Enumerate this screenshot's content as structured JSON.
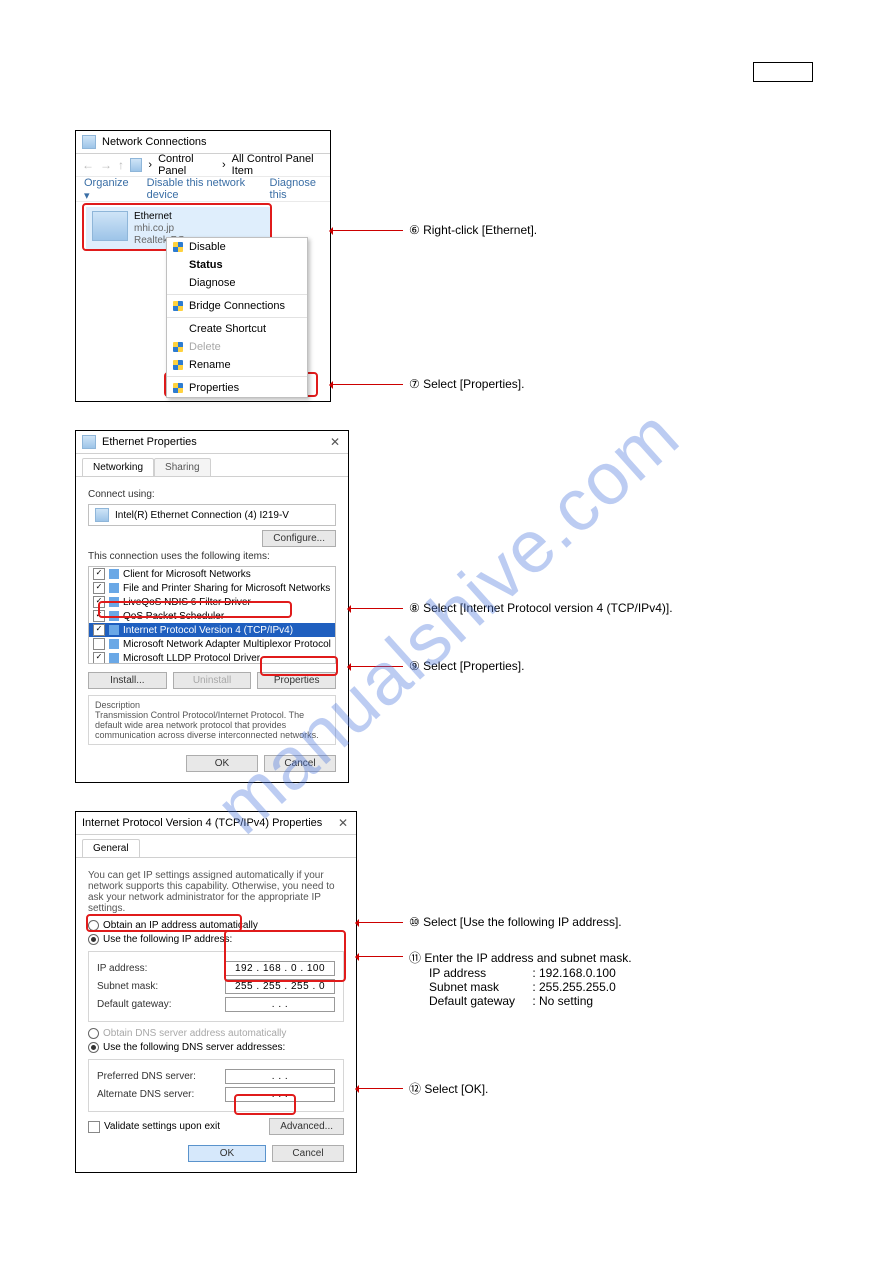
{
  "watermark": "manualshive.com",
  "fig1": {
    "title": "Network Connections",
    "nav_back": "←",
    "nav_fwd": "→",
    "nav_up": "↑",
    "breadcrumb_a": "Control Panel",
    "breadcrumb_sep": "›",
    "breadcrumb_b": "All Control Panel Item",
    "toolbar": {
      "organize": "Organize ▾",
      "disable": "Disable this network device",
      "diagnose": "Diagnose this"
    },
    "adapter": {
      "name": "Ethernet",
      "domain": "mhi.co.jp",
      "driver": "Realtek PC"
    },
    "ctx": {
      "disable": "Disable",
      "status": "Status",
      "diagnose": "Diagnose",
      "bridge": "Bridge Connections",
      "shortcut": "Create Shortcut",
      "delete": "Delete",
      "rename": "Rename",
      "properties": "Properties"
    },
    "annot6": "⑥ Right-click [Ethernet].",
    "annot7": "⑦ Select [Properties]."
  },
  "fig2": {
    "title": "Ethernet Properties",
    "tab_net": "Networking",
    "tab_share": "Sharing",
    "connect_using": "Connect using:",
    "adapter": "Intel(R) Ethernet Connection (4) I219-V",
    "configure": "Configure...",
    "uses_label": "This connection uses the following items:",
    "items": [
      "Client for Microsoft Networks",
      "File and Printer Sharing for Microsoft Networks",
      "LiveQoS NDIS 6 Filter Driver",
      "QoS Packet Scheduler",
      "Internet Protocol Version 4 (TCP/IPv4)",
      "Microsoft Network Adapter Multiplexor Protocol",
      "Microsoft LLDP Protocol Driver"
    ],
    "install": "Install...",
    "uninstall": "Uninstall",
    "properties": "Properties",
    "desc_title": "Description",
    "desc_body": "Transmission Control Protocol/Internet Protocol. The default wide area network protocol that provides communication across diverse interconnected networks.",
    "ok": "OK",
    "cancel": "Cancel",
    "annot8": "⑧ Select [Internet Protocol version 4 (TCP/IPv4)].",
    "annot9": "⑨ Select [Properties]."
  },
  "fig3": {
    "title": "Internet Protocol Version 4 (TCP/IPv4) Properties",
    "tab_general": "General",
    "intro": "You can get IP settings assigned automatically if your network supports this capability. Otherwise, you need to ask your network administrator for the appropriate IP settings.",
    "obtain_ip": "Obtain an IP address automatically",
    "use_ip": "Use the following IP address:",
    "ip_label": "IP address:",
    "ip_value": "192 . 168 .  0  . 100",
    "mask_label": "Subnet mask:",
    "mask_value": "255 . 255 . 255 .  0",
    "gw_label": "Default gateway:",
    "gw_value": ".       .       .",
    "obtain_dns": "Obtain DNS server address automatically",
    "use_dns": "Use the following DNS server addresses:",
    "pref_dns": "Preferred DNS server:",
    "alt_dns": "Alternate DNS server:",
    "dns_blank": ".       .       .",
    "validate": "Validate settings upon exit",
    "advanced": "Advanced...",
    "ok": "OK",
    "cancel": "Cancel",
    "annot10": "⑩ Select [Use the following IP address].",
    "annot11_head": "⑪ Enter the IP address and subnet mask.",
    "annot11_l1_a": "IP address",
    "annot11_l1_b": ": 192.168.0.100",
    "annot11_l2_a": "Subnet mask",
    "annot11_l2_b": ": 255.255.255.0",
    "annot11_l3_a": "Default gateway",
    "annot11_l3_b": ": No setting",
    "annot12": "⑫ Select [OK]."
  }
}
